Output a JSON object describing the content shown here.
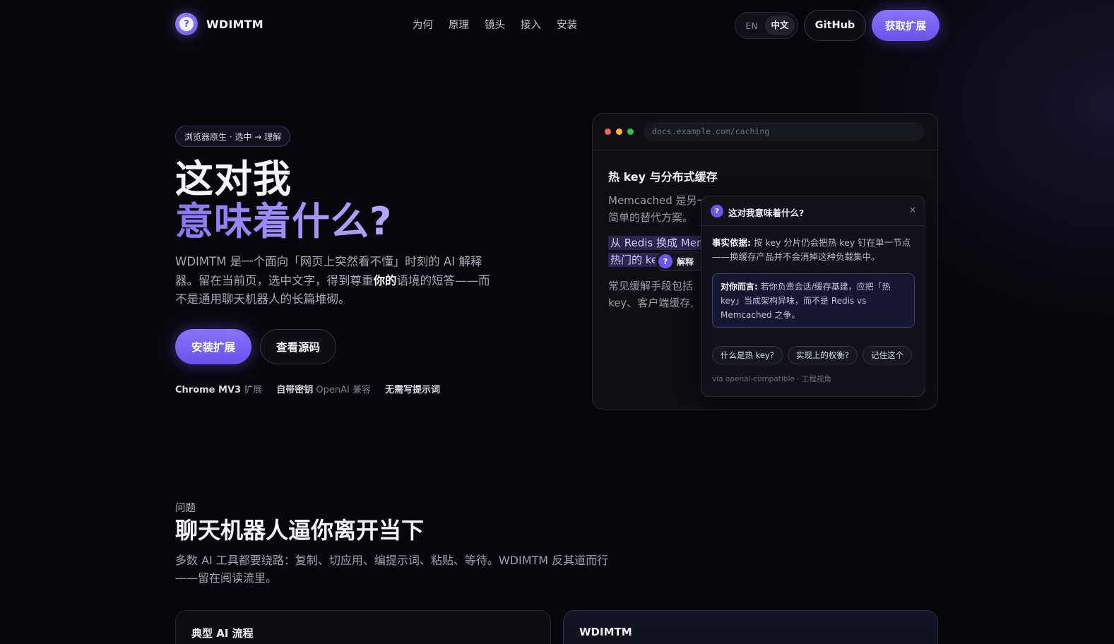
{
  "nav": {
    "brand": "WDIMTM",
    "logo_glyph": "?",
    "links": [
      "为何",
      "原理",
      "镜头",
      "接入",
      "安装"
    ],
    "lang_en": "EN",
    "lang_zh": "中文",
    "github": "GitHub",
    "cta": "获取扩展"
  },
  "hero": {
    "pill": "浏览器原生 · 选中 → 理解",
    "title_line1": "这对我",
    "title_line2": "意味着什么?",
    "lead_part1": "WDIMTM 是一个面向「网页上突然看不懂」时刻的 AI 解释器。留在当前页，选中文字，得到尊重",
    "lead_bold": "你的",
    "lead_part2": "语境的短答——而不是通用聊天机器人的长篇堆砌。",
    "btn_install": "安装扩展",
    "btn_source": "查看源码",
    "features": [
      {
        "bold": "Chrome MV3",
        "rest": "扩展"
      },
      {
        "bold": "自带密钥",
        "rest": "OpenAI 兼容"
      },
      {
        "bold": "无需写提示词",
        "rest": ""
      }
    ]
  },
  "mock": {
    "url": "docs.example.com/caching",
    "doc_title": "热 key 与分布式缓存",
    "p1_line1": "Memcached 是另一",
    "p1_line2": "简单的替代方案。",
    "hl_line1": "从 Redis 换成 Mem",
    "hl_line2": "热门的 ke",
    "p3_line1": "常见缓解手段包括",
    "p3_line2": "key、客户端缓存,",
    "explain_glyph": "?",
    "explain_label": "解释",
    "popup": {
      "glyph": "?",
      "title": "这对我意味着什么?",
      "close": "×",
      "fact_label": "事实依据:",
      "fact_text": "按 key 分片仍会把热 key 钉在单一节点——换缓存产品并不会消掉这种负载集中。",
      "you_label": "对你而言:",
      "you_text": "若你负责会话/缓存基建，应把「热 key」当成架构异味，而不是 Redis vs Memcached 之争。",
      "chips": [
        "什么是热 key?",
        "实现上的权衡?",
        "记住这个"
      ],
      "via": "via openai-compatible · 工程视角"
    }
  },
  "problem": {
    "eyebrow": "问题",
    "title": "聊天机器人逼你离开当下",
    "lead": "多数 AI 工具都要绕路：复制、切应用、编提示词、粘贴、等待。WDIMTM 反其道而行——留在阅读流里。",
    "card_left_title": "典型 AI 流程",
    "card_right_title": "WDIMTM"
  },
  "colors": {
    "accent": "#7c64f5",
    "background": "#07070b",
    "dot_red": "#ff5f57",
    "dot_yellow": "#febc2e",
    "dot_green": "#28c840"
  }
}
